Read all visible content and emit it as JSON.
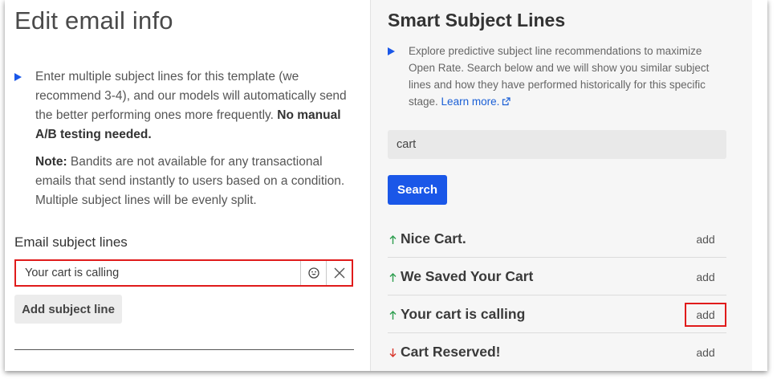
{
  "left": {
    "title": "Edit email info",
    "info_text": "Enter multiple subject lines for this template (we recommend 3-4), and our models will automatically send the better performing ones more frequently.",
    "info_bold": "No manual A/B testing needed.",
    "note_label": "Note:",
    "note_text": "Bandits are not available for any transactional emails that send instantly to users based on a condition. Multiple subject lines will be evenly split.",
    "section_label": "Email subject lines",
    "subject_value": "Your cart is calling",
    "add_subject_label": "Add subject line"
  },
  "right": {
    "title": "Smart Subject Lines",
    "explore_text": "Explore predictive subject line recommendations to maximize Open Rate. Search below and we will show you similar subject lines and how they have performed historically for this specific stage.",
    "learn_more": "Learn more.",
    "search_value": "cart",
    "search_button": "Search",
    "results": [
      {
        "text": "Nice Cart.",
        "trend": "up",
        "add": "add"
      },
      {
        "text": "We Saved Your Cart",
        "trend": "up",
        "add": "add"
      },
      {
        "text": "Your cart is calling",
        "trend": "up",
        "add": "add",
        "highlighted": true
      },
      {
        "text": "Cart Reserved!",
        "trend": "down",
        "add": "add"
      }
    ]
  },
  "colors": {
    "accent": "#1a57e8",
    "highlight": "#e01b1b",
    "trend_up": "#2e9e4f",
    "trend_down": "#d9362b"
  },
  "icons": [
    "play-bullet-icon",
    "emoji-icon",
    "close-icon",
    "external-link-icon",
    "arrow-up-icon",
    "arrow-down-icon"
  ]
}
